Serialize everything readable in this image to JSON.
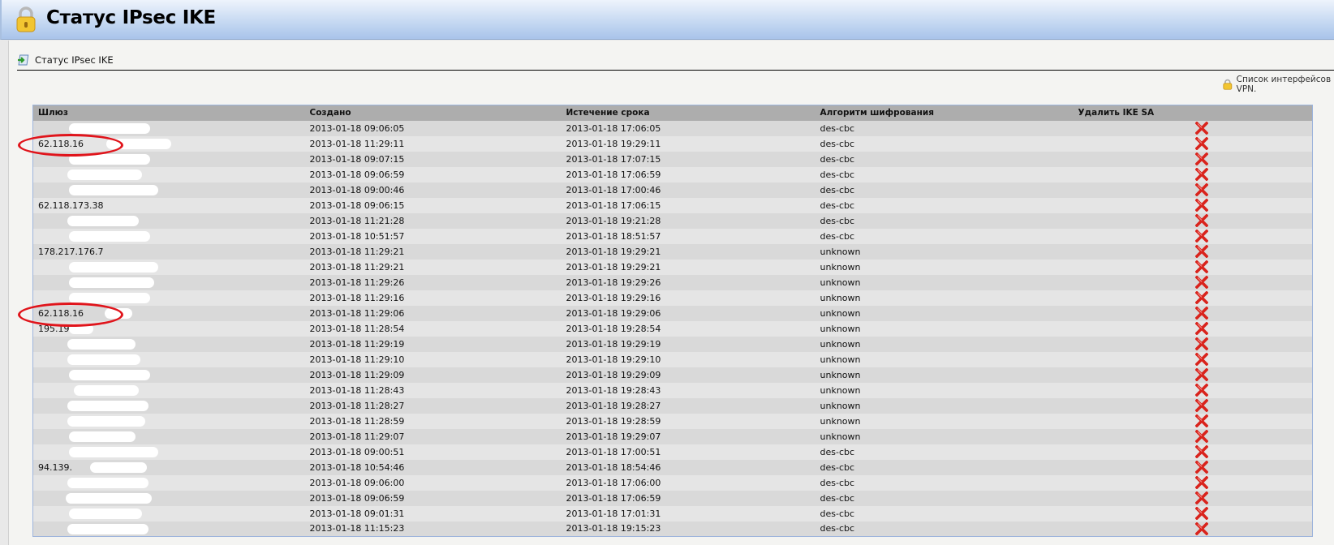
{
  "header": {
    "title": "Статус IPsec IKE"
  },
  "breadcrumb": {
    "label": "Статус IPsec IKE"
  },
  "vpn_link": {
    "label": "Список интерфейсов VPN."
  },
  "table": {
    "columns": [
      "Шлюз",
      "Создано",
      "Истечение срока",
      "Алгоритм шифрования",
      "Удалить IKE SA"
    ],
    "rows": [
      {
        "gateway": "",
        "created": "2013-01-18 09:06:05",
        "expires": "2013-01-18 17:06:05",
        "algorithm": "des-cbc"
      },
      {
        "gateway": "62.118.16",
        "created": "2013-01-18 11:29:11",
        "expires": "2013-01-18 19:29:11",
        "algorithm": "des-cbc"
      },
      {
        "gateway": "",
        "created": "2013-01-18 09:07:15",
        "expires": "2013-01-18 17:07:15",
        "algorithm": "des-cbc"
      },
      {
        "gateway": "",
        "created": "2013-01-18 09:06:59",
        "expires": "2013-01-18 17:06:59",
        "algorithm": "des-cbc"
      },
      {
        "gateway": "",
        "created": "2013-01-18 09:00:46",
        "expires": "2013-01-18 17:00:46",
        "algorithm": "des-cbc"
      },
      {
        "gateway": "62.118.173.38",
        "created": "2013-01-18 09:06:15",
        "expires": "2013-01-18 17:06:15",
        "algorithm": "des-cbc"
      },
      {
        "gateway": "",
        "created": "2013-01-18 11:21:28",
        "expires": "2013-01-18 19:21:28",
        "algorithm": "des-cbc"
      },
      {
        "gateway": "",
        "created": "2013-01-18 10:51:57",
        "expires": "2013-01-18 18:51:57",
        "algorithm": "des-cbc"
      },
      {
        "gateway": "178.217.176.7",
        "created": "2013-01-18 11:29:21",
        "expires": "2013-01-18 19:29:21",
        "algorithm": "unknown"
      },
      {
        "gateway": "",
        "created": "2013-01-18 11:29:21",
        "expires": "2013-01-18 19:29:21",
        "algorithm": "unknown"
      },
      {
        "gateway": "",
        "created": "2013-01-18 11:29:26",
        "expires": "2013-01-18 19:29:26",
        "algorithm": "unknown"
      },
      {
        "gateway": "",
        "created": "2013-01-18 11:29:16",
        "expires": "2013-01-18 19:29:16",
        "algorithm": "unknown"
      },
      {
        "gateway": "62.118.16",
        "created": "2013-01-18 11:29:06",
        "expires": "2013-01-18 19:29:06",
        "algorithm": "unknown"
      },
      {
        "gateway": "195.197",
        "created": "2013-01-18 11:28:54",
        "expires": "2013-01-18 19:28:54",
        "algorithm": "unknown"
      },
      {
        "gateway": "",
        "created": "2013-01-18 11:29:19",
        "expires": "2013-01-18 19:29:19",
        "algorithm": "unknown"
      },
      {
        "gateway": "",
        "created": "2013-01-18 11:29:10",
        "expires": "2013-01-18 19:29:10",
        "algorithm": "unknown"
      },
      {
        "gateway": "",
        "created": "2013-01-18 11:29:09",
        "expires": "2013-01-18 19:29:09",
        "algorithm": "unknown"
      },
      {
        "gateway": "",
        "created": "2013-01-18 11:28:43",
        "expires": "2013-01-18 19:28:43",
        "algorithm": "unknown"
      },
      {
        "gateway": "",
        "created": "2013-01-18 11:28:27",
        "expires": "2013-01-18 19:28:27",
        "algorithm": "unknown"
      },
      {
        "gateway": "",
        "created": "2013-01-18 11:28:59",
        "expires": "2013-01-18 19:28:59",
        "algorithm": "unknown"
      },
      {
        "gateway": "",
        "created": "2013-01-18 11:29:07",
        "expires": "2013-01-18 19:29:07",
        "algorithm": "unknown"
      },
      {
        "gateway": "",
        "created": "2013-01-18 09:00:51",
        "expires": "2013-01-18 17:00:51",
        "algorithm": "des-cbc"
      },
      {
        "gateway": "94.139.",
        "created": "2013-01-18 10:54:46",
        "expires": "2013-01-18 18:54:46",
        "algorithm": "des-cbc"
      },
      {
        "gateway": "",
        "created": "2013-01-18 09:06:00",
        "expires": "2013-01-18 17:06:00",
        "algorithm": "des-cbc"
      },
      {
        "gateway": "",
        "created": "2013-01-18 09:06:59",
        "expires": "2013-01-18 17:06:59",
        "algorithm": "des-cbc"
      },
      {
        "gateway": "",
        "created": "2013-01-18 09:01:31",
        "expires": "2013-01-18 17:01:31",
        "algorithm": "des-cbc"
      },
      {
        "gateway": "",
        "created": "2013-01-18 11:15:23",
        "expires": "2013-01-18 19:15:23",
        "algorithm": "des-cbc"
      }
    ]
  },
  "colors": {
    "delete_icon": "#d9231c",
    "annotation": "#e0141b",
    "header_bg": "#adadad"
  }
}
